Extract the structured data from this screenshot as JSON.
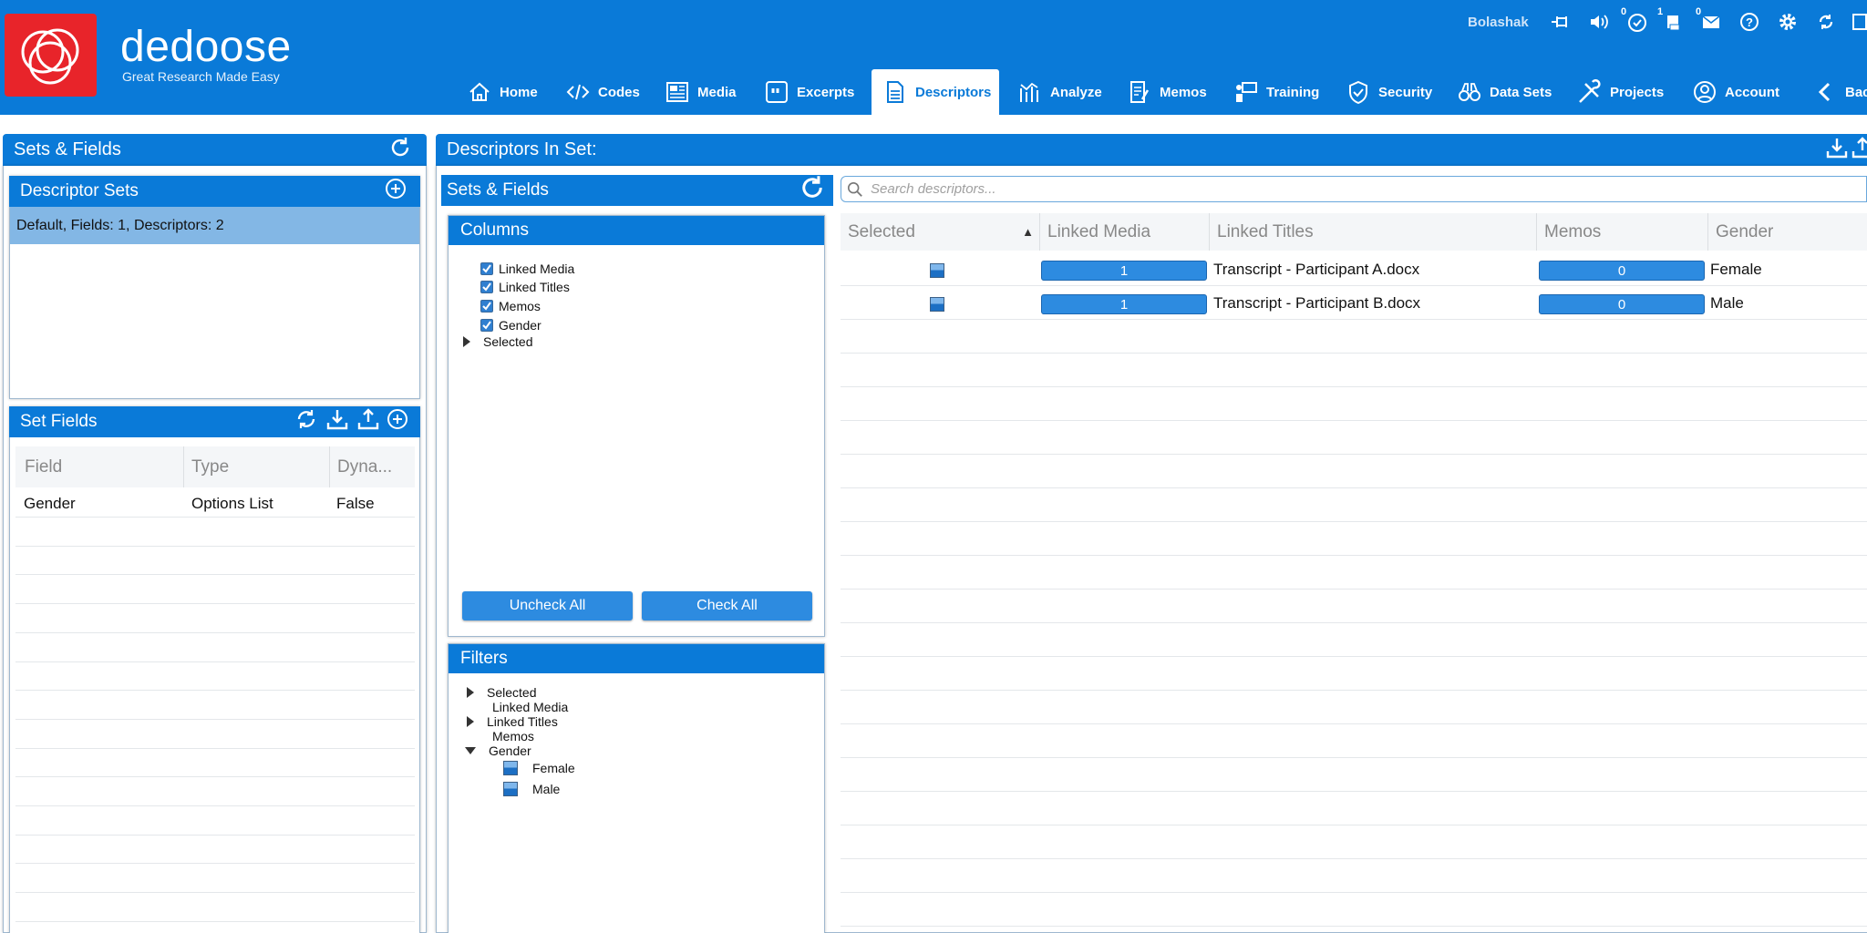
{
  "brand": {
    "name": "dedoose",
    "tagline": "Great Research Made Easy"
  },
  "header": {
    "user": "Bolashak",
    "badges": {
      "notifications": "0",
      "jobs": "1",
      "messages": "0"
    }
  },
  "nav": {
    "home": "Home",
    "codes": "Codes",
    "media": "Media",
    "excerpts": "Excerpts",
    "descriptors": "Descriptors",
    "analyze": "Analyze",
    "memos": "Memos",
    "training": "Training",
    "security": "Security",
    "datasets": "Data Sets",
    "projects": "Projects",
    "account": "Account",
    "back": "Back"
  },
  "left": {
    "title": "Sets & Fields",
    "descriptor_sets": {
      "title": "Descriptor Sets",
      "selected": "Default, Fields: 1, Descriptors: 2"
    },
    "set_fields": {
      "title": "Set Fields",
      "columns": [
        "Field",
        "Type",
        "Dyna..."
      ],
      "rows": [
        {
          "field": "Gender",
          "type": "Options List",
          "dynamic": "False"
        }
      ]
    }
  },
  "main": {
    "title": "Descriptors In Set:",
    "sets_fields_title": "Sets & Fields",
    "columns_panel": {
      "title": "Columns",
      "items": [
        "Linked Media",
        "Linked Titles",
        "Memos",
        "Gender"
      ],
      "collapsed": "Selected",
      "uncheck_all": "Uncheck All",
      "check_all": "Check All"
    },
    "filters_panel": {
      "title": "Filters",
      "items": [
        "Selected",
        "Linked Media",
        "Linked Titles",
        "Memos",
        "Gender"
      ],
      "gender_options": [
        "Female",
        "Male"
      ]
    },
    "search": {
      "placeholder": "Search descriptors..."
    },
    "grid": {
      "columns": [
        "Selected",
        "Linked Media",
        "Linked Titles",
        "Memos",
        "Gender"
      ],
      "sort_indicator": "▲",
      "rows": [
        {
          "linked_media": "1",
          "linked_title": "Transcript - Participant A.docx",
          "memos": "0",
          "gender": "Female"
        },
        {
          "linked_media": "1",
          "linked_title": "Transcript - Participant B.docx",
          "memos": "0",
          "gender": "Male"
        }
      ]
    }
  },
  "colors": {
    "primary": "#0a7ad8",
    "selected_row": "#83b7e5",
    "brand_red": "#e8242a"
  },
  "icons": [
    "refresh-icon",
    "add-icon",
    "download-icon",
    "upload-icon",
    "search-icon",
    "home-icon",
    "code-icon",
    "media-icon",
    "excerpt-icon",
    "descriptor-icon",
    "analyze-icon",
    "memo-icon",
    "training-icon",
    "shield-icon",
    "binoculars-icon",
    "tools-icon",
    "account-icon",
    "chevron-left-icon"
  ]
}
